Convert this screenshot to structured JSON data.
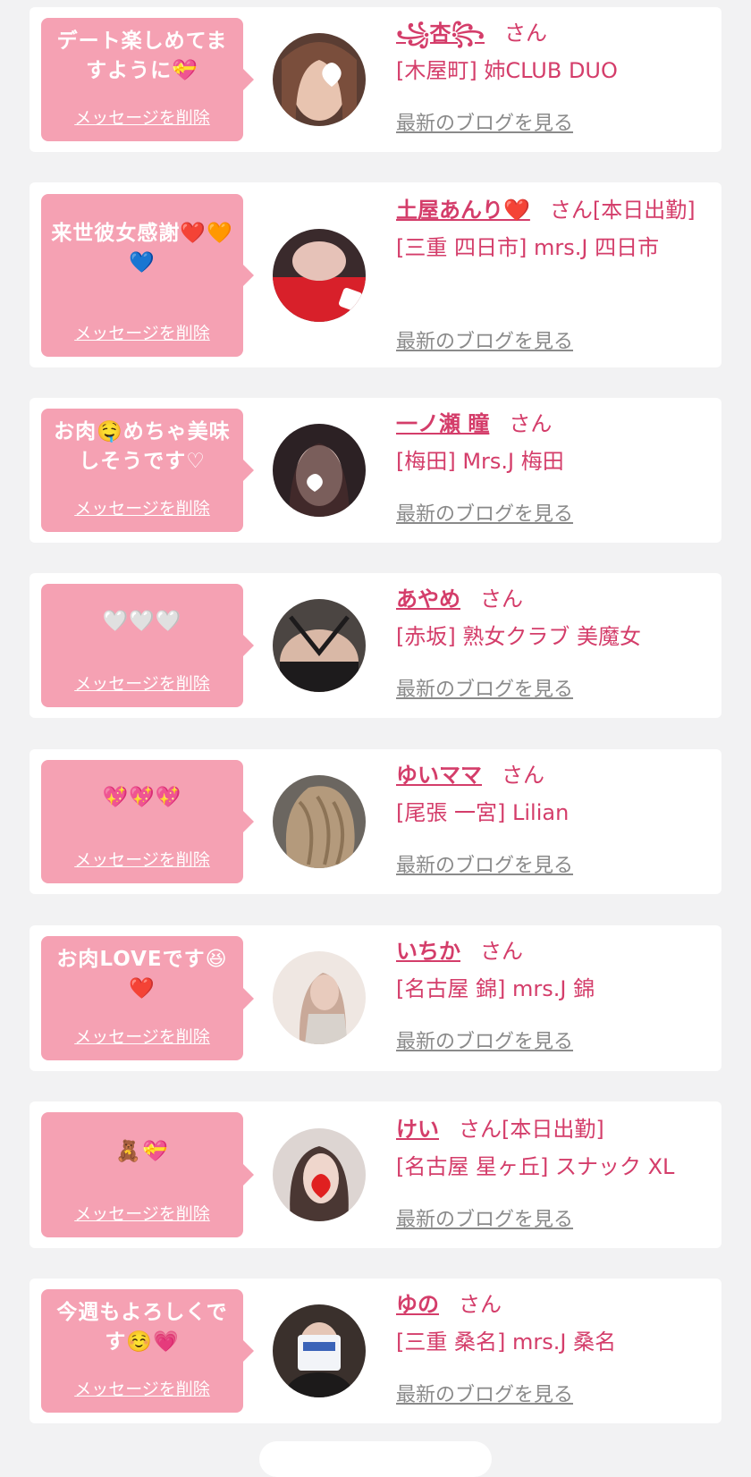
{
  "colors": {
    "background": "#f2f2f3",
    "card": "#ffffff",
    "bubble": "#f5a1b3",
    "accent": "#d43d6a",
    "link_gray": "#8a8a8a"
  },
  "labels": {
    "delete_message": "メッセージを削除",
    "view_blog": "最新のブログを見る",
    "honorific": "さん"
  },
  "cards": [
    {
      "message": "デート楽しめてますように💝",
      "name": "꧁杏꧂",
      "status": "",
      "shop": "[木屋町] 姉CLUB DUO"
    },
    {
      "message": "来世彼女感謝❤️🧡💙",
      "name": "土屋あんり❤️",
      "status": "[本日出勤]",
      "shop": "[三重 四日市] mrs.J 四日市"
    },
    {
      "message": "お肉🤤めちゃ美味しそうです♡",
      "name": "一ノ瀬 瞳",
      "status": "",
      "shop": "[梅田] Mrs.J 梅田"
    },
    {
      "message": "🤍🤍🤍",
      "name": "あやめ",
      "status": "",
      "shop": "[赤坂] 熟女クラブ 美魔女"
    },
    {
      "message": "💖💖💖",
      "name": "ゆいママ",
      "status": "",
      "shop": "[尾張 一宮] Lilian"
    },
    {
      "message": "お肉LOVEです😆❤️",
      "name": "いちか",
      "status": "",
      "shop": "[名古屋 錦] mrs.J 錦"
    },
    {
      "message": "🧸💝",
      "name": "けい",
      "status": "[本日出勤]",
      "shop": "[名古屋 星ヶ丘] スナック XL"
    },
    {
      "message": "今週もよろしくです☺️💗",
      "name": "ゆの",
      "status": "",
      "shop": "[三重 桑名] mrs.J 桑名"
    }
  ]
}
